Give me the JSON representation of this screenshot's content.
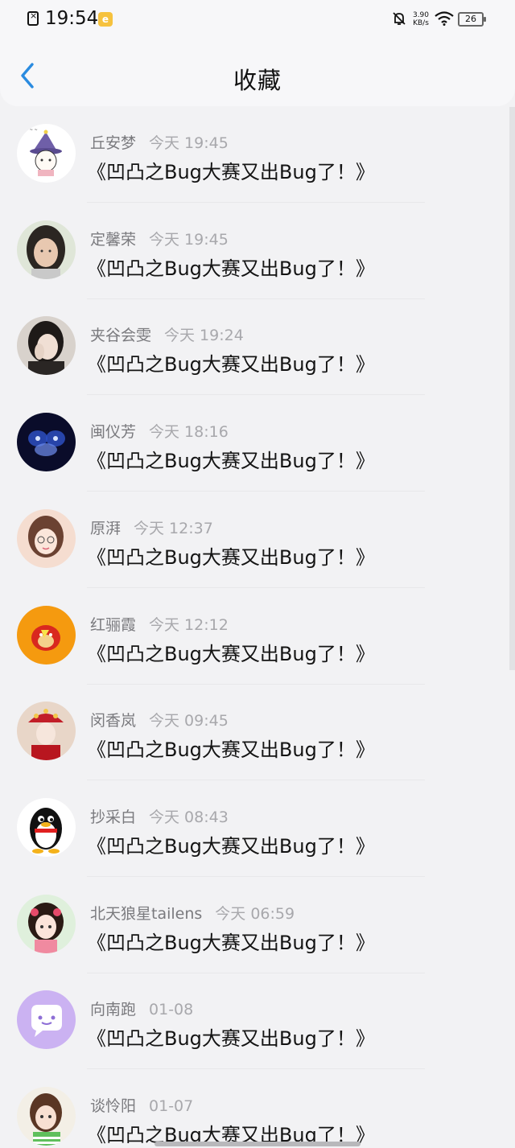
{
  "status_bar": {
    "time": "19:54",
    "app_badge": "e",
    "net_speed_value": "3.90",
    "net_speed_unit": "KB/s",
    "battery": "26"
  },
  "header": {
    "title": "收藏"
  },
  "favorites": [
    {
      "name": "丘安梦",
      "time": "今天 19:45",
      "message": "《凹凸之Bug大赛又出Bug了！》"
    },
    {
      "name": "定馨荣",
      "time": "今天 19:45",
      "message": "《凹凸之Bug大赛又出Bug了！》"
    },
    {
      "name": "夹谷会雯",
      "time": "今天 19:24",
      "message": "《凹凸之Bug大赛又出Bug了！》"
    },
    {
      "name": "闽仪芳",
      "time": "今天 18:16",
      "message": "《凹凸之Bug大赛又出Bug了！》"
    },
    {
      "name": "原湃",
      "time": "今天 12:37",
      "message": "《凹凸之Bug大赛又出Bug了！》"
    },
    {
      "name": "红骊霞",
      "time": "今天 12:12",
      "message": "《凹凸之Bug大赛又出Bug了！》"
    },
    {
      "name": "闵香岚",
      "time": "今天 09:45",
      "message": "《凹凸之Bug大赛又出Bug了！》"
    },
    {
      "name": "抄采白",
      "time": "今天 08:43",
      "message": "《凹凸之Bug大赛又出Bug了！》"
    },
    {
      "name": "北天狼星tailens",
      "time": "今天 06:59",
      "message": "《凹凸之Bug大赛又出Bug了！》"
    },
    {
      "name": "向南跑",
      "time": "01-08",
      "message": "《凹凸之Bug大赛又出Bug了！》"
    },
    {
      "name": "谈怜阳",
      "time": "01-07",
      "message": "《凹凸之Bug大赛又出Bug了！》"
    }
  ],
  "colors": {
    "accent": "#2a8be0",
    "background": "#f2f2f4",
    "text_primary": "#141414",
    "text_secondary": "#7a7a7e",
    "text_time": "#a8a8ac"
  }
}
